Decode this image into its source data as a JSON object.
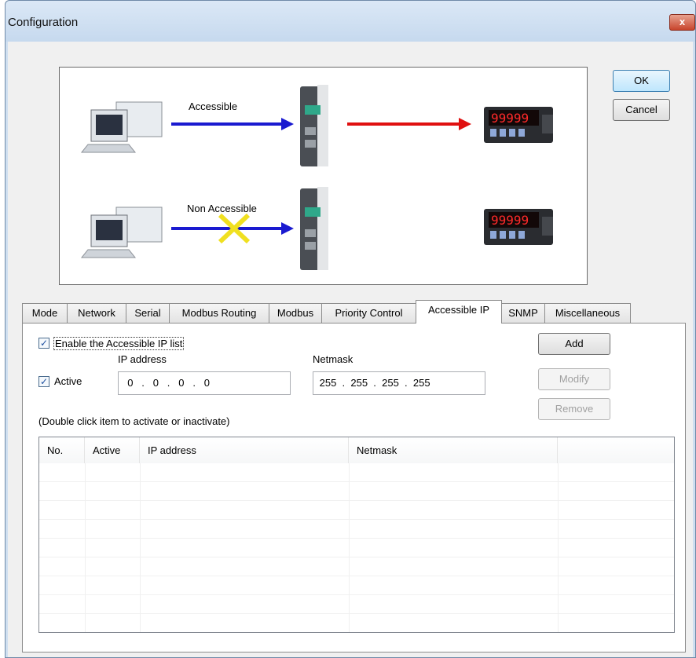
{
  "window": {
    "title": "Configuration",
    "close_glyph": "x"
  },
  "buttons": {
    "ok": "OK",
    "cancel": "Cancel",
    "add": "Add",
    "modify": "Modify",
    "remove": "Remove"
  },
  "diagram": {
    "label_accessible": "Accessible",
    "label_non_accessible": "Non Accessible",
    "meter_display": "99999"
  },
  "tabs": [
    {
      "label": "Mode"
    },
    {
      "label": "Network"
    },
    {
      "label": "Serial"
    },
    {
      "label": "Modbus Routing"
    },
    {
      "label": "Modbus"
    },
    {
      "label": "Priority Control"
    },
    {
      "label": "Accessible IP"
    },
    {
      "label": "SNMP"
    },
    {
      "label": "Miscellaneous"
    }
  ],
  "active_tab": "Accessible IP",
  "form": {
    "enable_label": "Enable the Accessible IP list",
    "enable_checked": true,
    "active_label": "Active",
    "active_checked": true,
    "ip_label": "IP address",
    "ip_value": "  0   .   0   .   0   .   0",
    "netmask_label": "Netmask",
    "netmask_value": " 255  .  255  .  255  .  255",
    "hint": "(Double click item to activate or inactivate)",
    "check_glyph": "✓"
  },
  "table": {
    "columns": [
      "No.",
      "Active",
      "IP address",
      "Netmask"
    ],
    "rows": []
  },
  "colors": {
    "accessible_arrow": "#1a1ad0",
    "output_arrow": "#e01010",
    "blocked_mark": "#f0e020"
  }
}
